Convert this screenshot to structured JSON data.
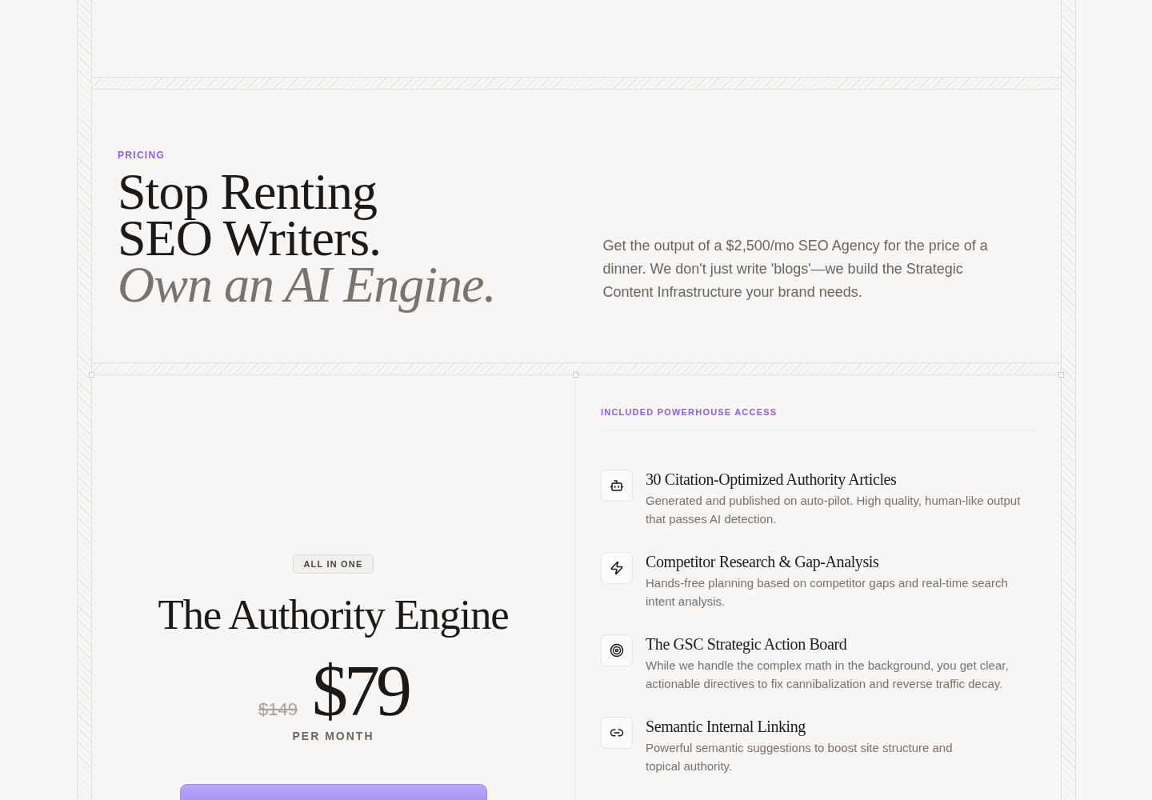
{
  "hero": {
    "eyebrow": "PRICING",
    "title_lines": [
      {
        "text": "Stop Renting",
        "kind": "plain"
      },
      {
        "text": "SEO Writers.",
        "kind": "plain"
      },
      {
        "text": "Own an AI Engine.",
        "kind": "accent"
      }
    ],
    "description": "Get the output of a $2,500/mo SEO Agency for the price of a dinner. We don't just write 'blogs'—we build the Strategic Content Infrastructure your brand needs."
  },
  "plan": {
    "badge": "ALL IN ONE",
    "name": "The Authority Engine",
    "old_price": "$149",
    "price": "$79",
    "period": "PER MONTH"
  },
  "features": {
    "heading": "INCLUDED POWERHOUSE ACCESS",
    "items": [
      {
        "kind": "robot",
        "title": "30 Citation-Optimized Authority Articles",
        "description": "Generated and published on auto-pilot. High quality, human-like output that passes AI detection."
      },
      {
        "kind": "bolt",
        "title": "Competitor Research & Gap-Analysis",
        "description": "Hands-free planning based on competitor gaps and real-time search intent analysis."
      },
      {
        "kind": "target",
        "title": "The GSC Strategic Action Board",
        "description": "While we handle the complex math in the background, you get clear, actionable directives to fix cannibalization and reverse traffic decay."
      },
      {
        "kind": "link",
        "title": "Semantic Internal Linking",
        "description": "Powerful semantic suggestions to boost site structure and\ntopical authority."
      }
    ]
  }
}
